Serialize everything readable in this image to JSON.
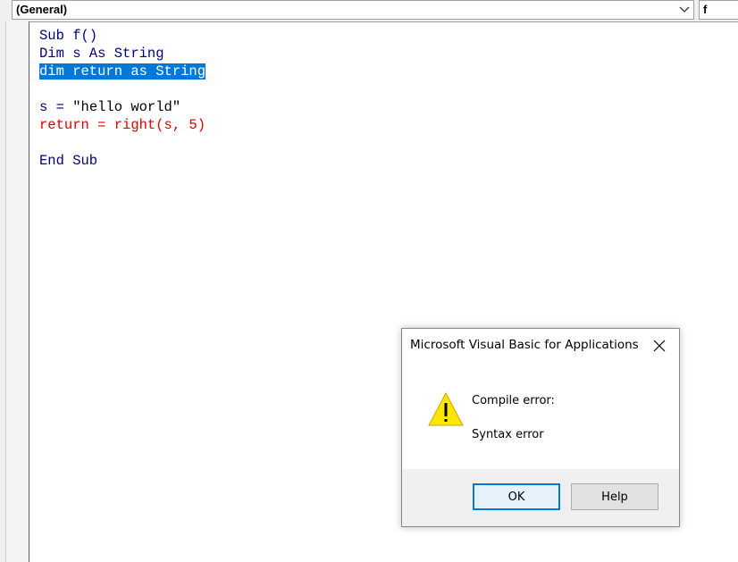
{
  "toolbar": {
    "object_combo": "(General)",
    "procedure_combo": "f"
  },
  "code": {
    "lines": {
      "l1": "Sub f()",
      "l2": "Dim s As String",
      "l3": "dim return as String",
      "l5a": "s = ",
      "l5b": "\"hello world\"",
      "l6": "return = right(s, 5)",
      "l8": "End Sub"
    }
  },
  "dialog": {
    "title": "Microsoft Visual Basic for Applications",
    "message_line1": "Compile error:",
    "message_line2": "Syntax error",
    "ok_label": "OK",
    "help_label": "Help",
    "icon": "warning-icon"
  },
  "colors": {
    "keyword": "#000080",
    "error_line": "#e00000",
    "selection": "#0078d7"
  }
}
